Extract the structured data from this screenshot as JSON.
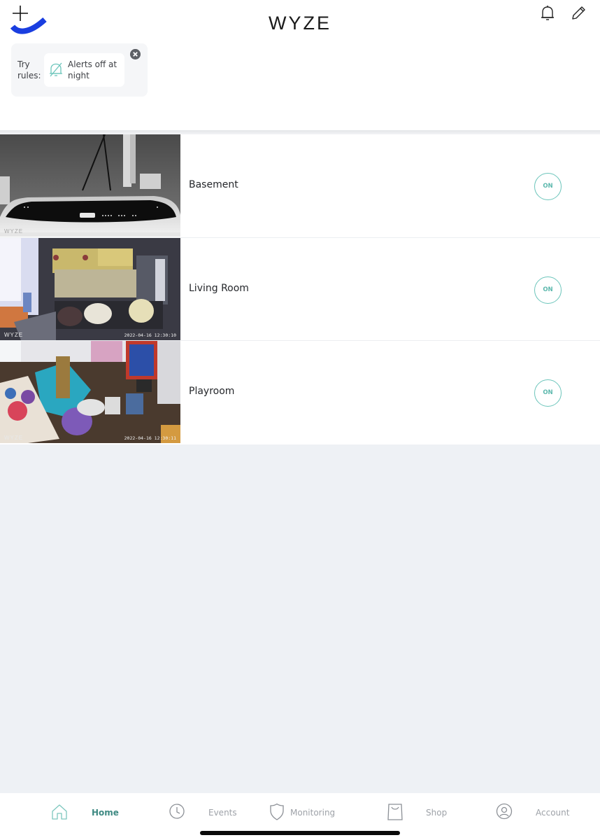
{
  "header": {
    "logo": "WYZE",
    "add_icon": "plus-icon",
    "notifications_icon": "bell-icon",
    "edit_icon": "pencil-icon"
  },
  "rules": {
    "label": "Try rules:",
    "chip_icon": "bell-off-icon",
    "chip_label": "Alerts off at night",
    "close_icon": "close-circle-icon"
  },
  "devices": [
    {
      "name": "Basement",
      "status": "ON",
      "timestamp": "",
      "watermark": "WYZE"
    },
    {
      "name": "Living Room",
      "status": "ON",
      "timestamp": "2022-04-16 12:30:10",
      "watermark": "WYZE"
    },
    {
      "name": "Playroom",
      "status": "ON",
      "timestamp": "2022-04-16 12:30:11",
      "watermark": "WYZE"
    }
  ],
  "nav": {
    "items": [
      {
        "label": "Home",
        "icon": "home-icon",
        "active": true
      },
      {
        "label": "Events",
        "icon": "clock-icon",
        "active": false
      },
      {
        "label": "Monitoring",
        "icon": "shield-icon",
        "active": false
      },
      {
        "label": "Shop",
        "icon": "shopping-bag-icon",
        "active": false
      },
      {
        "label": "Account",
        "icon": "account-icon",
        "active": false
      }
    ]
  },
  "colors": {
    "accent": "#5cb8ad",
    "brand_blue": "#1a3ee0",
    "background": "#eef1f5"
  }
}
